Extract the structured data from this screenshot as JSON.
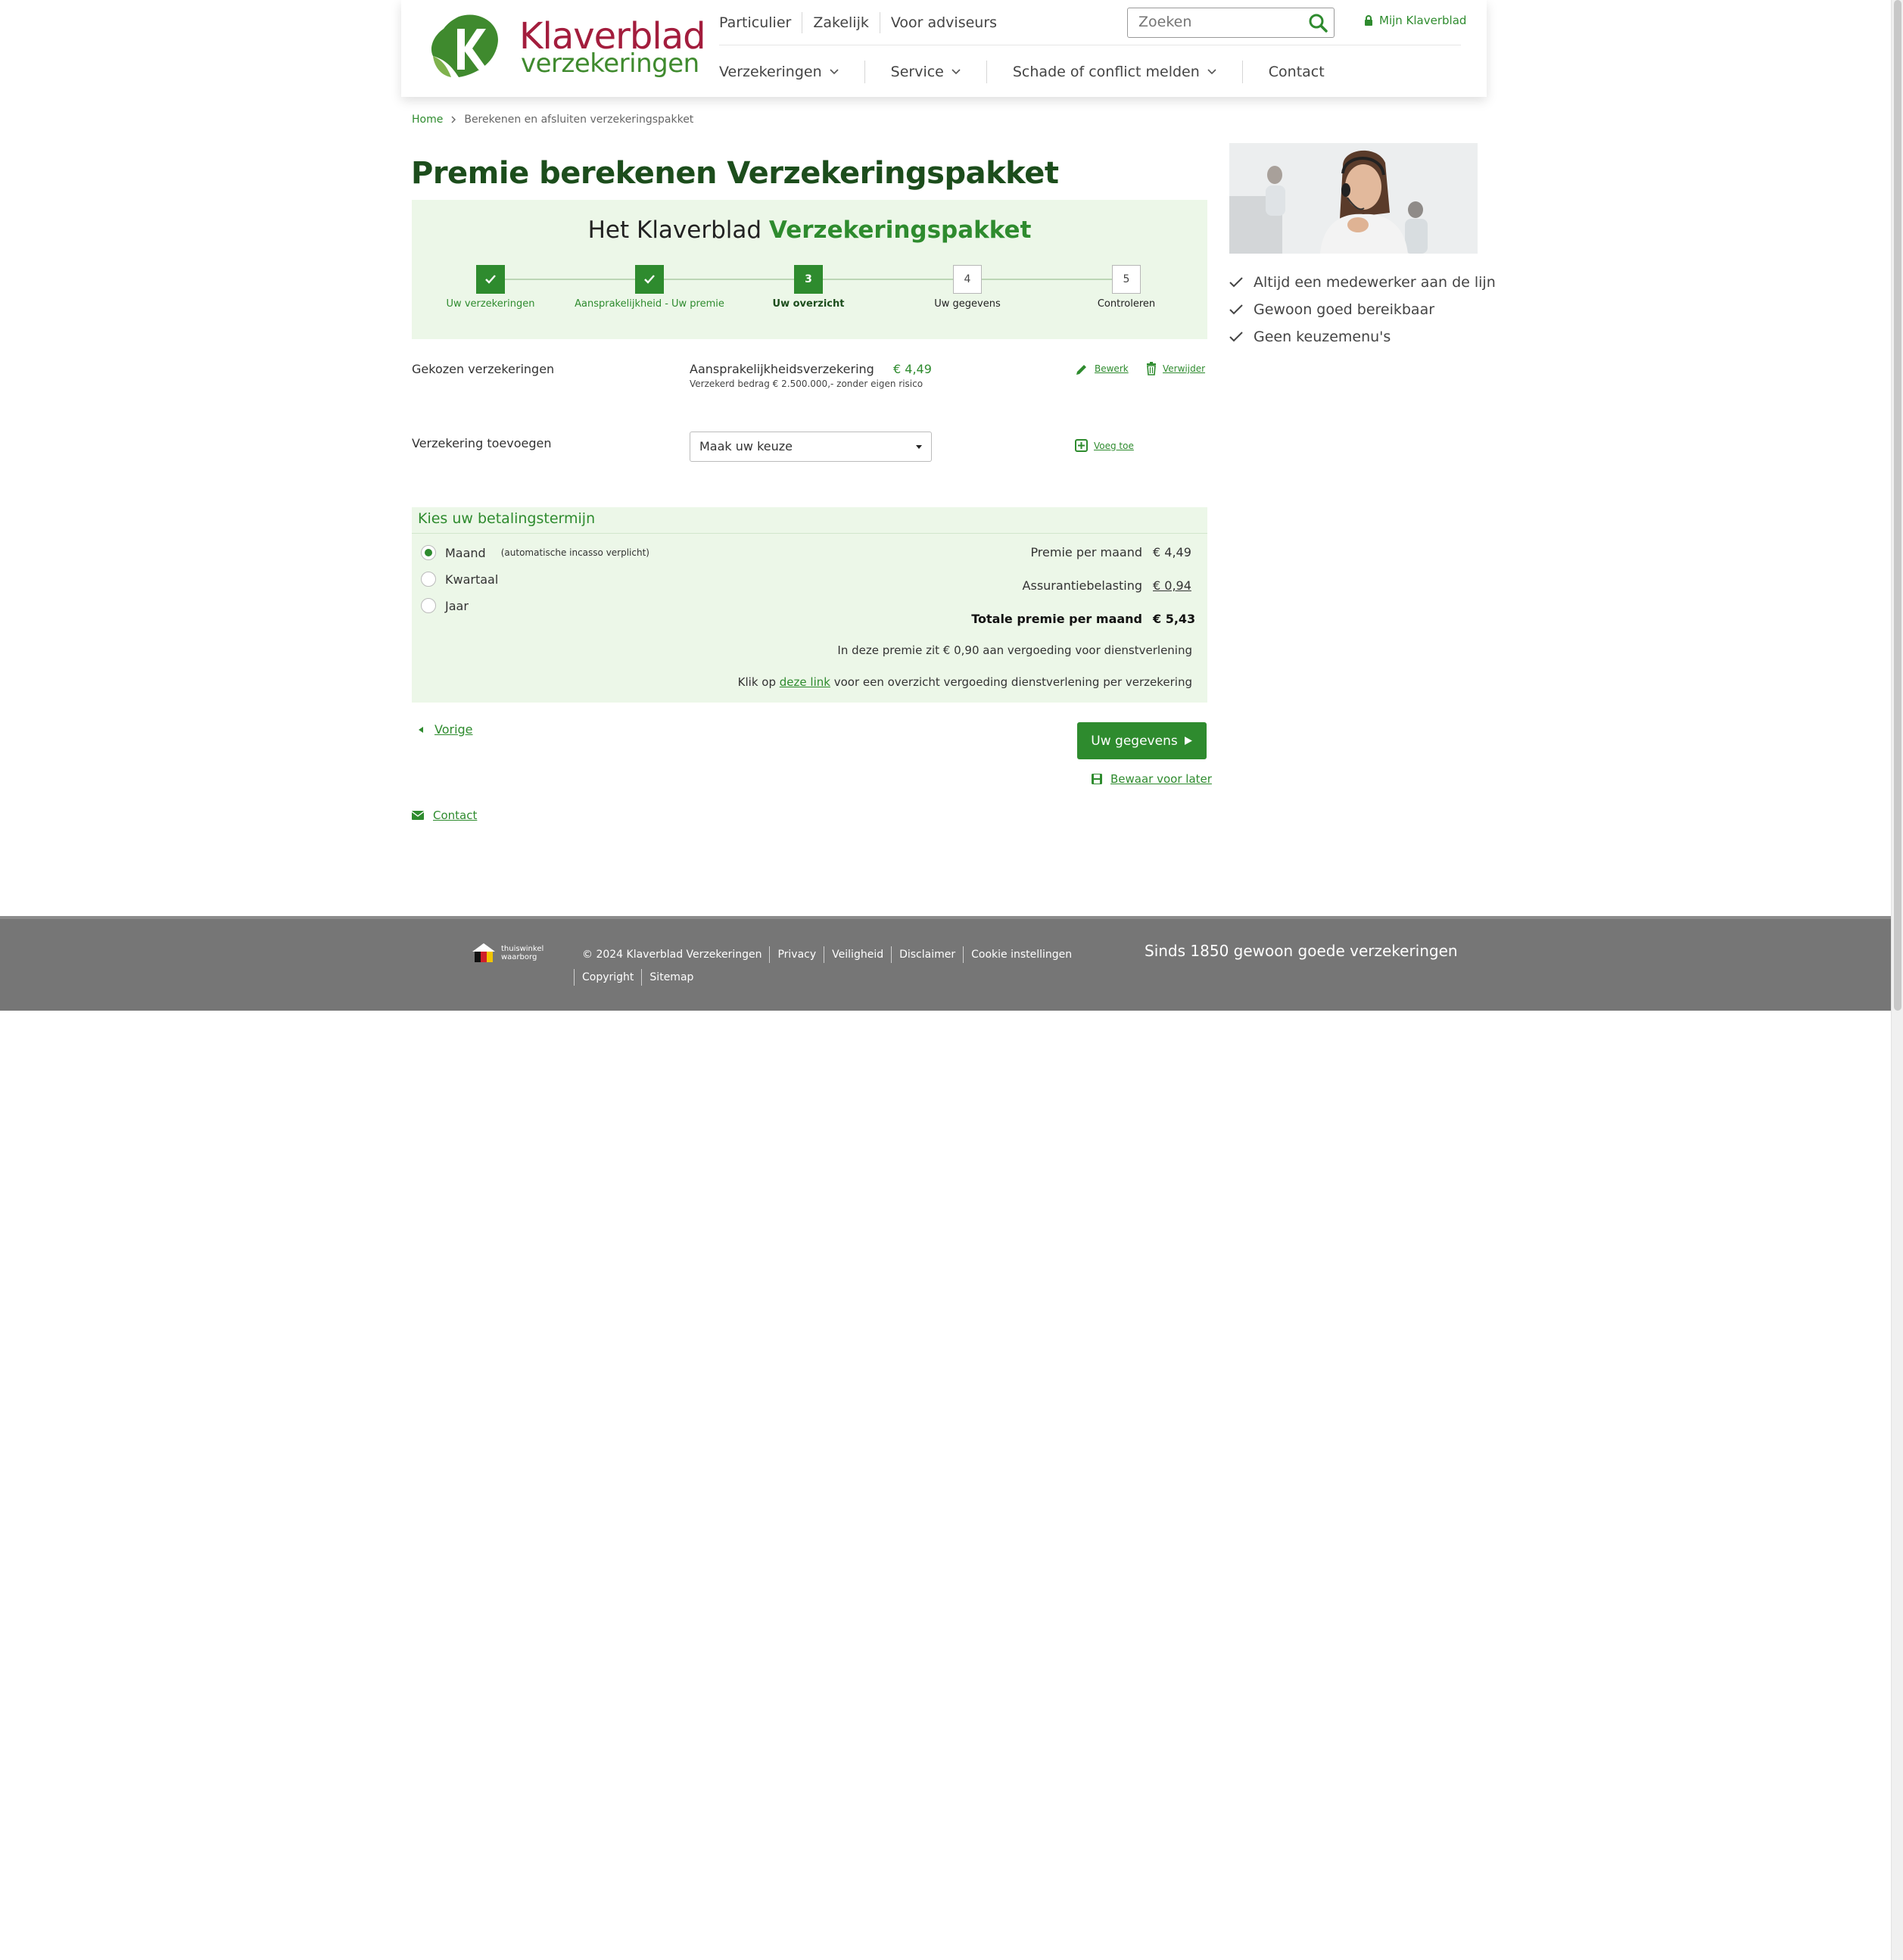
{
  "header": {
    "logo": {
      "title": "Klaverblad",
      "subtitle": "verzekeringen"
    },
    "top_nav": [
      "Particulier",
      "Zakelijk",
      "Voor adviseurs"
    ],
    "search_placeholder": "Zoeken",
    "account_link": "Mijn Klaverblad",
    "main_nav": [
      {
        "label": "Verzekeringen",
        "has_dropdown": true
      },
      {
        "label": "Service",
        "has_dropdown": true
      },
      {
        "label": "Schade of conflict melden",
        "has_dropdown": true
      },
      {
        "label": "Contact",
        "has_dropdown": false
      }
    ]
  },
  "breadcrumb": [
    "Home",
    "Berekenen en afsluiten verzekeringspakket"
  ],
  "page_title": "Premie berekenen Verzekeringspakket",
  "wizard": {
    "title_prefix": "Het Klaverblad",
    "title_highlight": "Verzekeringspakket",
    "steps": [
      {
        "number": "1",
        "label": "Uw verzekeringen",
        "state": "done"
      },
      {
        "number": "2",
        "label": "Aansprakelijkheid - Uw premie",
        "state": "done"
      },
      {
        "number": "3",
        "label": "Uw overzicht",
        "state": "active"
      },
      {
        "number": "4",
        "label": "Uw gegevens",
        "state": "todo"
      },
      {
        "number": "5",
        "label": "Controleren",
        "state": "todo"
      }
    ]
  },
  "chosen": {
    "label": "Gekozen verzekeringen",
    "insurance_name": "Aansprakelijkheidsverzekering",
    "insurance_price": "€  4,49",
    "insurance_detail": "Verzekerd bedrag €  2.500.000,-  zonder eigen risico",
    "edit_label": "Bewerk",
    "remove_label": "Verwijder"
  },
  "add": {
    "label": "Verzekering toevoegen",
    "select_value": "Maak uw keuze",
    "add_label": "Voeg toe"
  },
  "payment": {
    "title": "Kies uw betalingstermijn",
    "options": [
      {
        "label": "Maand",
        "note": "(automatische incasso verplicht)",
        "selected": true
      },
      {
        "label": "Kwartaal",
        "note": "",
        "selected": false
      },
      {
        "label": "Jaar",
        "note": "",
        "selected": false
      }
    ],
    "premium_label": "Premie per maand",
    "premium_value": "€  4,49",
    "tax_label": "Assurantiebelasting",
    "tax_value": "€  0,94",
    "total_label": "Totale premie per maand",
    "total_value": "€  5,43",
    "fee_note": "In deze premie zit €  0,90 aan vergoeding voor dienstverlening",
    "link_note_prefix": "Klik op",
    "link_text": "deze link",
    "link_note_suffix": "voor een overzicht vergoeding dienstverlening per verzekering"
  },
  "actions": {
    "back_label": "Vorige",
    "next_label": "Uw gegevens",
    "save_label": "Bewaar voor later",
    "contact_label": "Contact"
  },
  "sidebar": {
    "usps": [
      "Altijd een medewerker aan de lijn",
      "Gewoon goed bereikbaar",
      "Geen keuzemenu's"
    ]
  },
  "footer": {
    "badge_line1": "thuiswinkel",
    "badge_line2": "waarborg",
    "copyright": "© 2024 Klaverblad Verzekeringen",
    "links": [
      "Privacy",
      "Veiligheid",
      "Disclaimer",
      "Cookie instellingen",
      "Copyright",
      "Sitemap"
    ],
    "slogan": "Sinds 1850 gewoon goede verzekeringen"
  },
  "colors": {
    "brand_green": "#2e8b2e",
    "title_green": "#1c4d1c",
    "brand_red": "#a31d3d",
    "panel_bg": "#ecf7e8",
    "footer_bg": "#767676"
  }
}
